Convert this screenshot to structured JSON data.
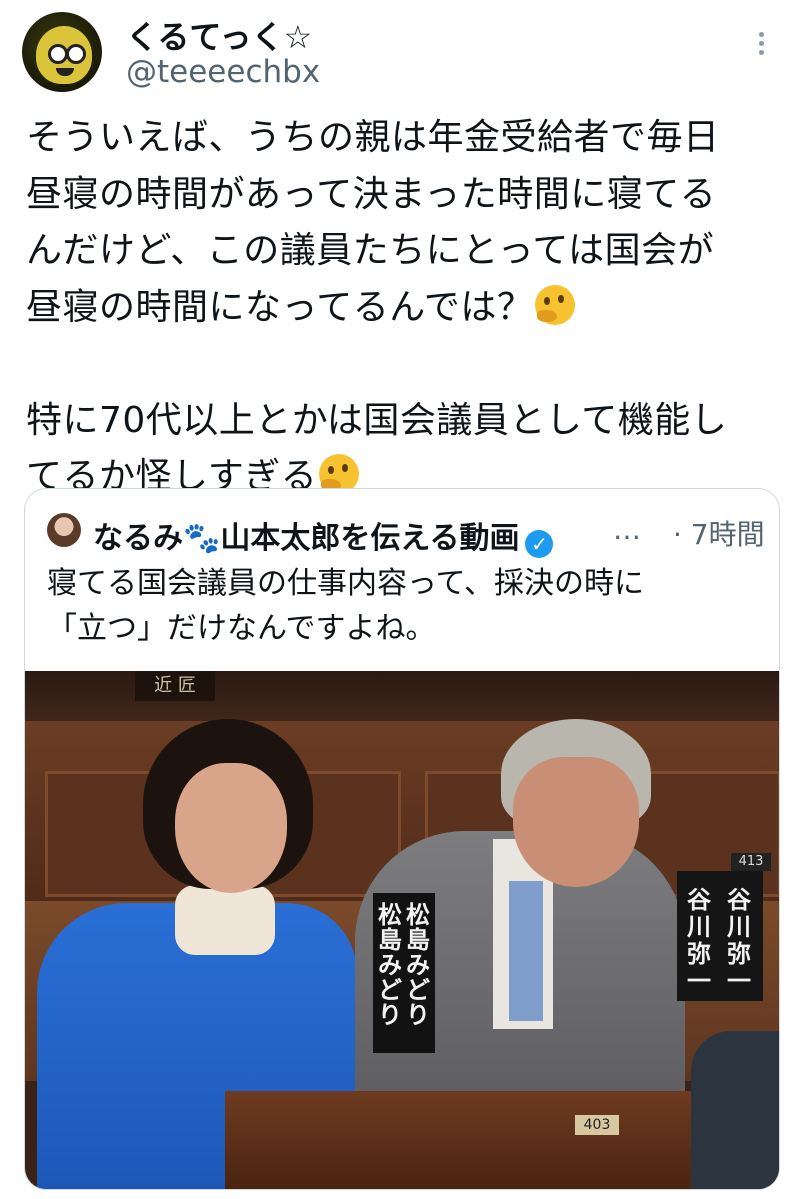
{
  "author": {
    "display_name": "くるてっく☆",
    "handle": "@teeeechbx"
  },
  "tweet": {
    "text": "そういえば、うちの親は年金受給者で毎日\n昼寝の時間があって決まった時間に寝てる\nんだけど、この議員たちにとっては国会が\n昼寝の時間になってるんでは？",
    "text2": "\n\n特に70代以上とかは国会議員として機能し\nてるか怪しすぎる",
    "emoji": "thinking-face"
  },
  "quote": {
    "display_name": "なるみ🐾山本太郎を伝える動画",
    "verified": true,
    "more": "…",
    "time": "· 7時間",
    "text": "寝てる国会議員の仕事内容って、採決の時に\n「立つ」だけなんですよね。",
    "photo": {
      "nameplate_1": [
        "松",
        "島",
        "み",
        "ど",
        "り"
      ],
      "nameplate_2": [
        "谷",
        "川",
        "弥",
        "一"
      ],
      "seat_number": "403",
      "seat_number_2": "413",
      "sign": "近 匠"
    }
  }
}
